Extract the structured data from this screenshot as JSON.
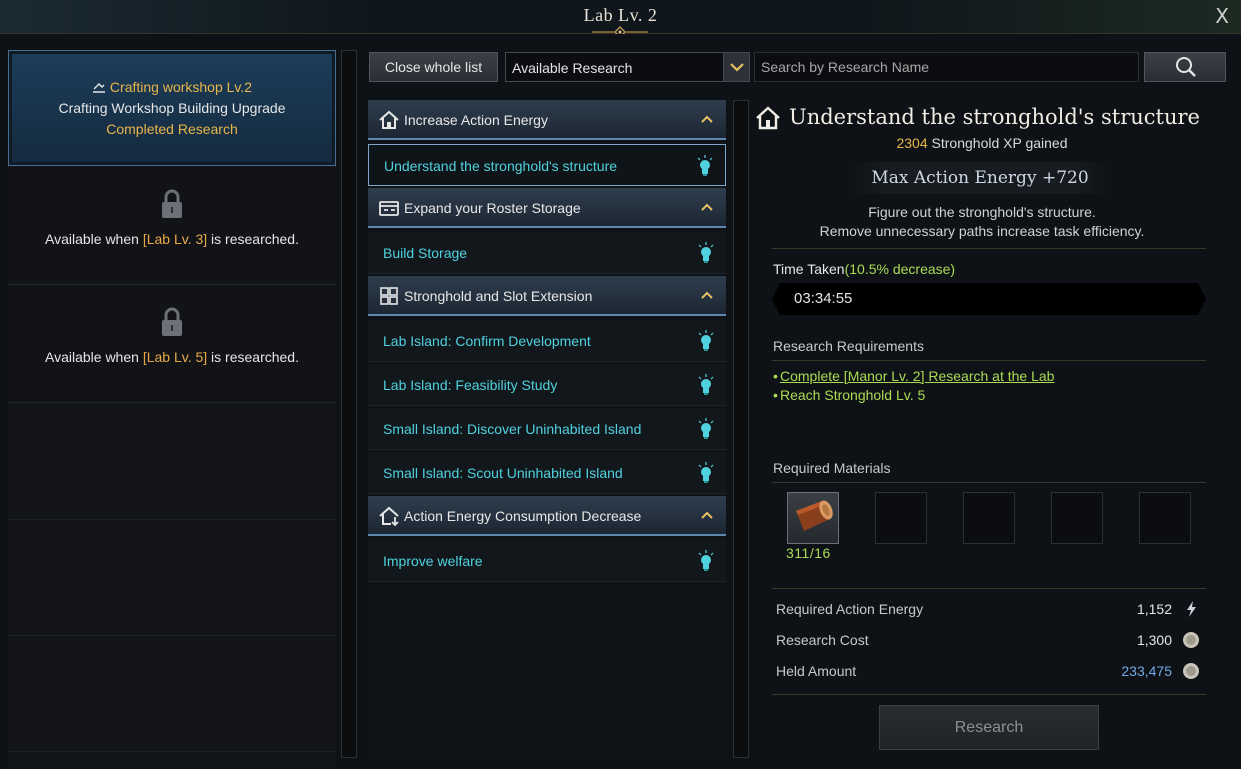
{
  "window": {
    "title": "Lab Lv. 2",
    "close_label": "X"
  },
  "left_panel": {
    "active": {
      "title": "Crafting workshop Lv.2",
      "subtitle": "Crafting Workshop Building Upgrade",
      "status": "Completed Research"
    },
    "locked": [
      {
        "prefix": "Available when ",
        "requirement": "[Lab Lv. 3]",
        "suffix": " is researched."
      },
      {
        "prefix": "Available when ",
        "requirement": "[Lab Lv. 5]",
        "suffix": " is researched."
      }
    ]
  },
  "toolbar": {
    "close_list_label": "Close whole list",
    "filter_selected": "Available Research",
    "search_placeholder": "Search by Research Name"
  },
  "list": {
    "categories": [
      {
        "label": "Increase Action Energy",
        "icon": "house-icon",
        "items": [
          "Understand the stronghold's structure"
        ]
      },
      {
        "label": "Expand your Roster Storage",
        "icon": "storage-icon",
        "items": [
          "Build Storage"
        ]
      },
      {
        "label": "Stronghold and Slot Extension",
        "icon": "grid-icon",
        "items": [
          "Lab Island: Confirm Development",
          "Lab Island: Feasibility Study",
          "Small Island: Discover Uninhabited Island",
          "Small Island: Scout Uninhabited Island"
        ]
      },
      {
        "label": "Action Energy Consumption Decrease",
        "icon": "house-down-icon",
        "items": [
          "Improve welfare"
        ]
      }
    ]
  },
  "detail": {
    "title": "Understand the stronghold's structure",
    "xp_amount": "2304",
    "xp_suffix": " Stronghold XP gained",
    "bonus": "Max Action Energy +720",
    "description_line1": "Figure out the stronghold's structure.",
    "description_line2": "Remove unnecessary paths increase task efficiency.",
    "time_label": "Time Taken",
    "time_decrease": "(10.5% decrease)",
    "time_value": "03:34:55",
    "requirements_label": "Research Requirements",
    "requirements": [
      "Complete [Manor Lv. 2] Research at the Lab",
      "Reach Stronghold Lv. 5"
    ],
    "materials_label": "Required Materials",
    "material_count": "311/16",
    "required_energy_label": "Required Action Energy",
    "required_energy_value": "1,152",
    "research_cost_label": "Research Cost",
    "research_cost_value": "1,300",
    "held_amount_label": "Held Amount",
    "held_amount_value": "233,475",
    "research_button": "Research"
  },
  "colors": {
    "accent_gold": "#e8b64a",
    "item_cyan": "#4fd2de",
    "green": "#a9dc53",
    "blue": "#73a7e6"
  }
}
